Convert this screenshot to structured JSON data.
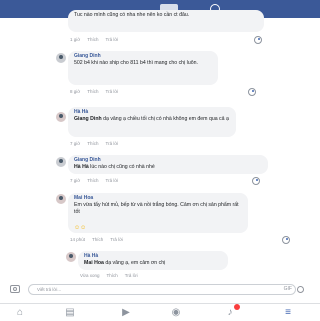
{
  "comments": [
    {
      "text": "Tuc nào mình cũng có nha nhe nên ko cần ct đâu.",
      "meta": {
        "time": "1 giờ",
        "like": "Thích",
        "reply": "Trả lời"
      }
    },
    {
      "name": "Giang Dinh",
      "text": "502 b4 khi nào ship cho 811 b4 thì mang cho chị luôn.",
      "meta": {
        "time": "8 giờ",
        "like": "Thích",
        "reply": "Trả lời"
      }
    },
    {
      "name": "Hà Hà",
      "mention": "Giang Dinh",
      "text": " dạ vâng ạ chiều tối chị có nhà không em đem qua cả ạ",
      "meta": {
        "time": "7 giờ",
        "like": "Thích",
        "reply": "Trả lời"
      }
    },
    {
      "name": "Giang Dinh",
      "mention": "Hà Hà",
      "text": " lúc nào chị cũng có nhà nhé",
      "meta": {
        "time": "7 giờ",
        "like": "Thích",
        "reply": "Trả lời"
      }
    },
    {
      "name": "Mai Hoa",
      "text": "Em vừa tẩy hút mủ, bếp từ và nồi trắng bóng. Cảm ơn chị sản phẩm rất tốt",
      "meta": {
        "time": "14 phút",
        "like": "Thích",
        "reply": "Trả lời"
      }
    },
    {
      "name": "Hà Hà",
      "mention": "Mai Hoa",
      "text": " dạ vâng ạ, em cảm ơn chị",
      "meta": {
        "time": "Vừa xong",
        "like": "Thích",
        "reply": "Trả lời"
      }
    }
  ],
  "composer": {
    "placeholder": "Viết trả lời...",
    "gif_label": "GIF"
  },
  "icons": {
    "nav": [
      "home-icon",
      "feed-icon",
      "video-icon",
      "notifications-icon",
      "bell-icon",
      "menu-icon"
    ]
  }
}
